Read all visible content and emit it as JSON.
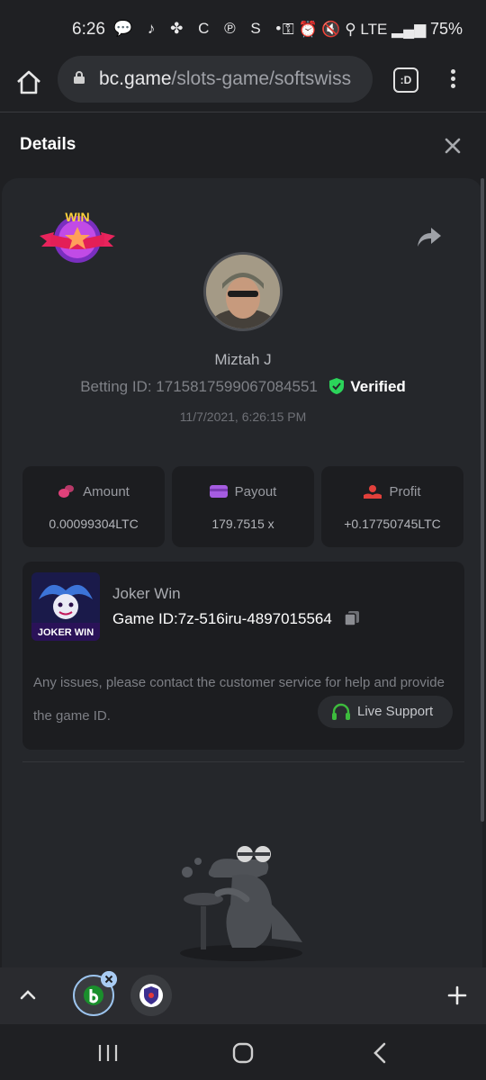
{
  "status_bar": {
    "time": "6:26",
    "notification_icons": "💬 ♪ ✤ C ℗ S •",
    "right_icons": "⚿ ⏰ 🔇 ⚲ LTE ▂▄▆",
    "battery": "75%"
  },
  "browser": {
    "url_domain": "bc.game",
    "url_path": "/slots-game/softswiss",
    "tabs_label": ":D"
  },
  "header": {
    "title": "Details"
  },
  "bet": {
    "username": "Miztah J",
    "betting_id": "Betting ID: 1715817599067084551",
    "verified_label": "Verified",
    "timestamp": "11/7/2021, 6:26:15 PM",
    "win_badge_text": "WIN"
  },
  "stats": [
    {
      "label": "Amount",
      "value": "0.00099304LTC",
      "icon": "coins-icon",
      "color": "#e0417a"
    },
    {
      "label": "Payout",
      "value": "179.7515 x",
      "icon": "wallet-icon",
      "color": "#a55ce0"
    },
    {
      "label": "Profit",
      "value": "+0.17750745LTC",
      "icon": "hand-coin-icon",
      "color": "#e2403b"
    }
  ],
  "game": {
    "name": "Joker Win",
    "game_id_label": "Game ID:",
    "game_id": "7z-516iru-4897015564",
    "thumb_text": "JOKER WIN",
    "issues_text": "Any issues, please contact the customer service for help and provide the game ID.",
    "live_support_label": "Live Support"
  },
  "colors": {
    "background": "#1f2023",
    "panel": "#25272b",
    "card": "#1c1d20",
    "verified_green": "#2bd45a",
    "support_green": "#3dbb3d"
  }
}
